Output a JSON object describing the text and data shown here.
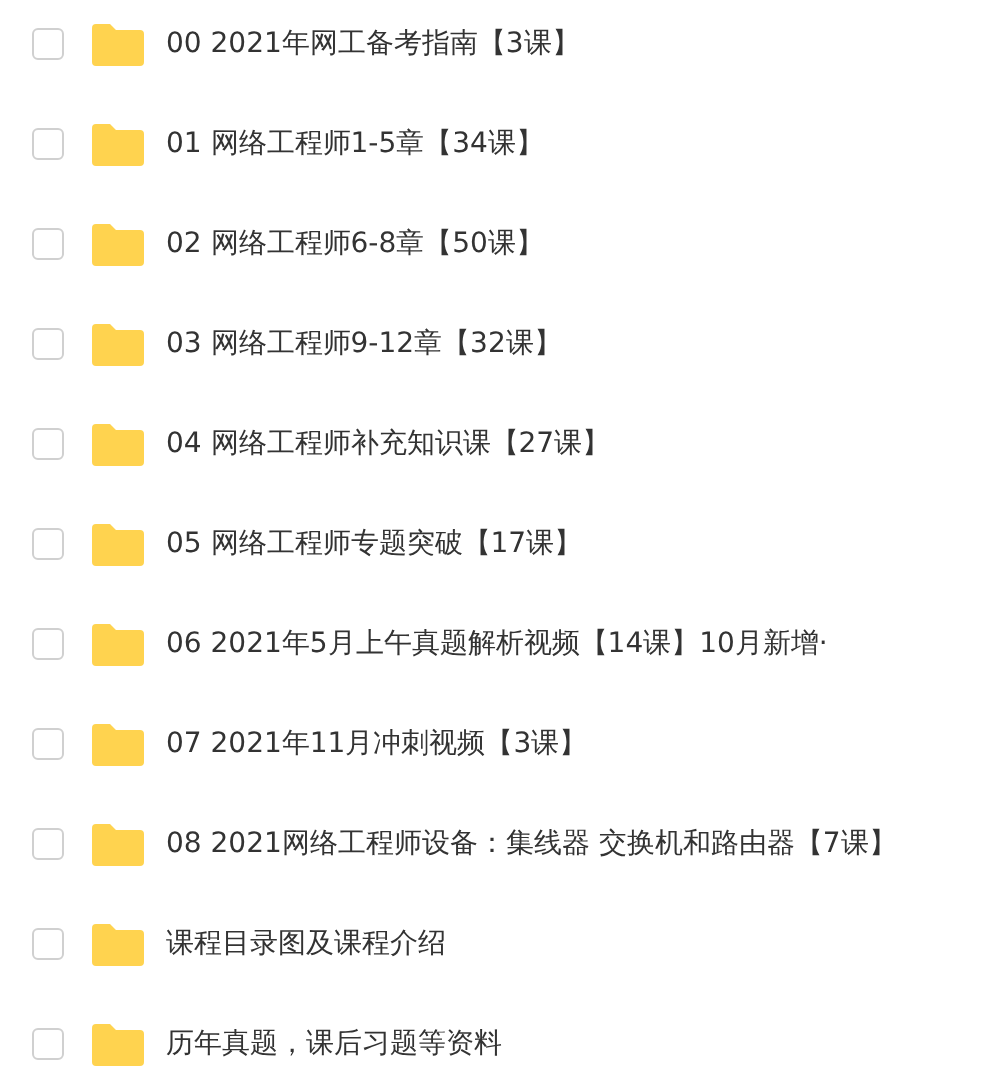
{
  "folders": [
    {
      "name": "00 2021年网工备考指南【3课】",
      "checked": false
    },
    {
      "name": "01 网络工程师1-5章【34课】",
      "checked": false
    },
    {
      "name": "02 网络工程师6-8章【50课】",
      "checked": false
    },
    {
      "name": "03 网络工程师9-12章【32课】",
      "checked": false
    },
    {
      "name": "04 网络工程师补充知识课【27课】",
      "checked": false
    },
    {
      "name": "05 网络工程师专题突破【17课】",
      "checked": false
    },
    {
      "name": "06 2021年5月上午真题解析视频【14课】10月新增·",
      "checked": false
    },
    {
      "name": "07 2021年11月冲刺视频【3课】",
      "checked": false
    },
    {
      "name": "08 2021网络工程师设备：集线器 交换机和路由器【7课】",
      "checked": false
    },
    {
      "name": "课程目录图及课程介绍",
      "checked": false
    },
    {
      "name": "历年真题，课后习题等资料",
      "checked": false
    }
  ]
}
